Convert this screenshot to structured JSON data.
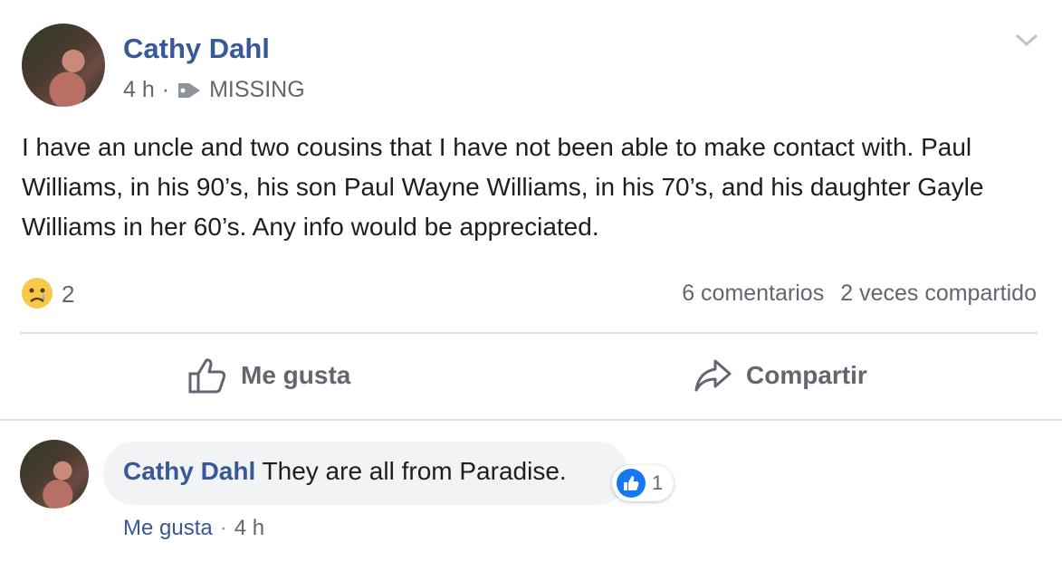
{
  "post": {
    "author": "Cathy Dahl",
    "time": "4 h",
    "separator": "·",
    "tag": "MISSING",
    "text": "I have an uncle and two cousins that I have not been able to make contact with. Paul Williams, in his 90’s, his son Paul Wayne Williams, in his 70’s, and his daughter Gayle Williams in her 60’s. Any info would be appreciated.",
    "reaction_count": "2",
    "comments": "6 comentarios",
    "shares": "2 veces compartido"
  },
  "actions": {
    "like_label": "Me gusta",
    "share_label": "Compartir"
  },
  "comment": {
    "author": "Cathy Dahl",
    "text": "They are all from Paradise.",
    "like_count": "1",
    "like_label": "Me gusta",
    "separator": "·",
    "time": "4 h"
  },
  "colors": {
    "link": "#385898",
    "meta": "#606770",
    "bubble": "#f2f3f5",
    "like_blue": "#1877f2"
  }
}
